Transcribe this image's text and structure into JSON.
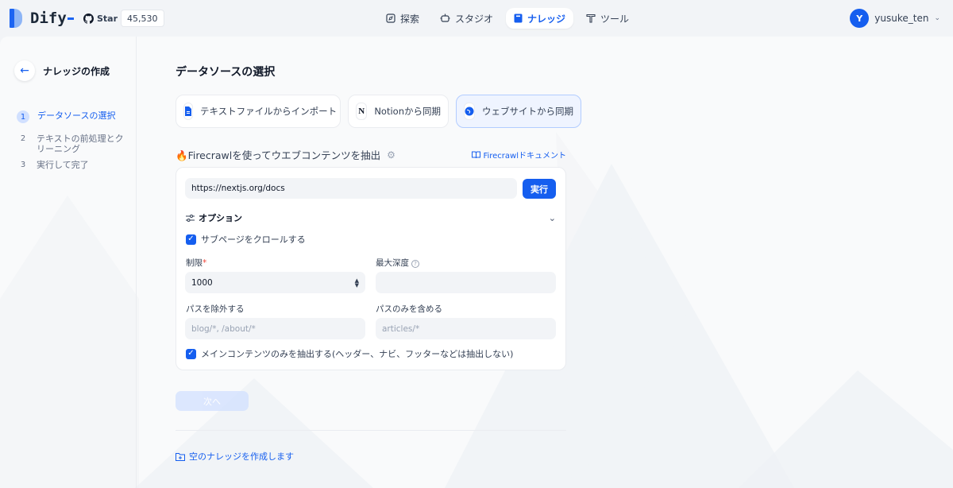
{
  "header": {
    "brand": "Dify",
    "github": {
      "star_label": "Star",
      "count": "45,530"
    },
    "nav": [
      {
        "label": "探索",
        "icon": "compass-icon",
        "active": false
      },
      {
        "label": "スタジオ",
        "icon": "robot-icon",
        "active": false
      },
      {
        "label": "ナレッジ",
        "icon": "book-icon",
        "active": true
      },
      {
        "label": "ツール",
        "icon": "hammer-icon",
        "active": false
      }
    ],
    "user": {
      "avatar_letter": "Y",
      "name": "yusuke_ten"
    }
  },
  "sidebar": {
    "title": "ナレッジの作成",
    "steps": [
      {
        "num": "1",
        "label": "データソースの選択",
        "active": true
      },
      {
        "num": "2",
        "label": "テキストの前処理とクリーニング",
        "active": false
      },
      {
        "num": "3",
        "label": "実行して完了",
        "active": false
      }
    ]
  },
  "main": {
    "title": "データソースの選択",
    "sources": [
      {
        "label": "テキストファイルからインポート",
        "icon": "file-icon",
        "active": false
      },
      {
        "label": "Notionから同期",
        "icon": "notion-icon",
        "active": false
      },
      {
        "label": "ウェブサイトから同期",
        "icon": "globe-icon",
        "active": true
      }
    ],
    "firecrawl": {
      "title": "🔥Firecrawlを使ってウエブコンテンツを抽出",
      "doc_link": "Firecrawlドキュメント"
    },
    "form": {
      "url_value": "https://nextjs.org/docs",
      "run_label": "実行",
      "options_label": "オプション",
      "crawl_sub_pages": "サブページをクロールする",
      "limit_label": "制限",
      "limit_value": "1000",
      "max_depth_label": "最大深度",
      "max_depth_value": "",
      "exclude_label": "パスを除外する",
      "exclude_placeholder": "blog/*, /about/*",
      "include_label": "パスのみを含める",
      "include_placeholder": "articles/*",
      "main_content_only": "メインコンテンツのみを抽出する(ヘッダー、ナビ、フッターなどは抽出しない)"
    },
    "next_label": "次へ",
    "empty_link": "空のナレッジを作成します"
  },
  "colors": {
    "accent": "#155eef",
    "accent_light": "#eff4ff",
    "background": "#f9fafb"
  }
}
